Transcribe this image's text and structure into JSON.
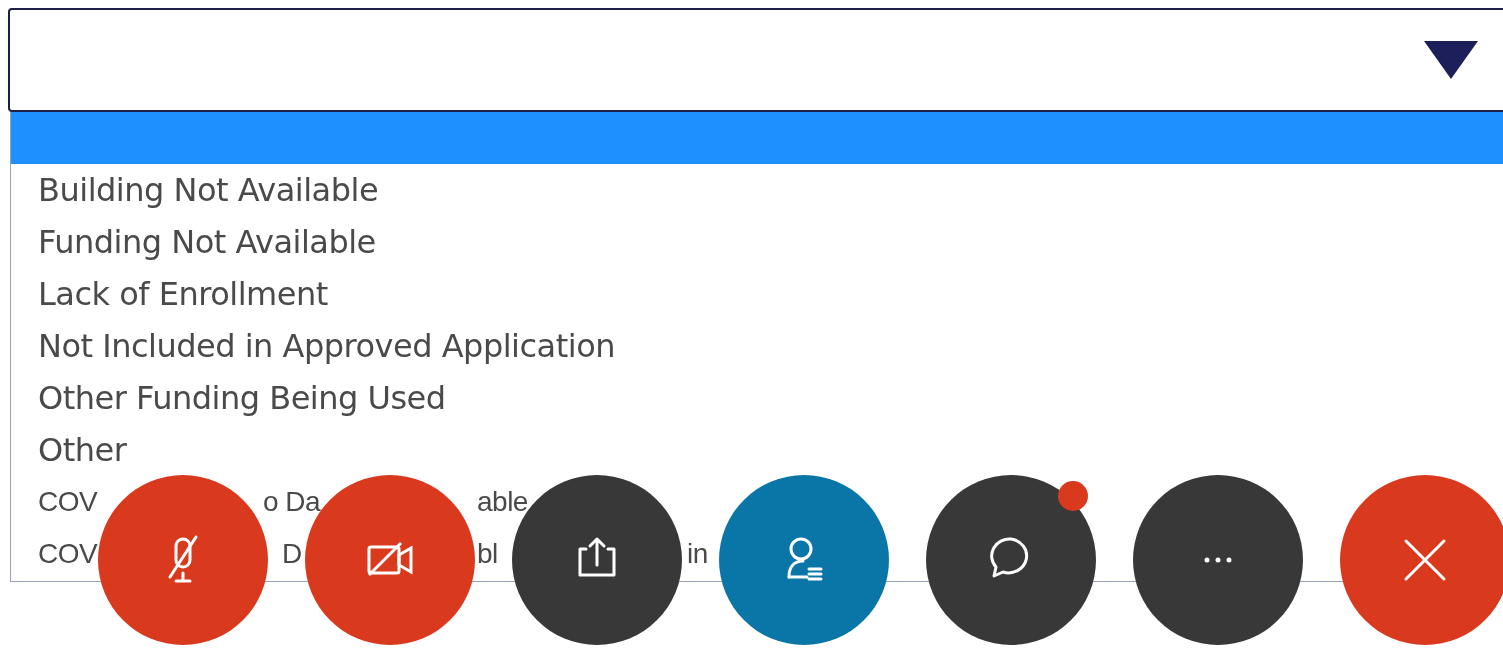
{
  "dropdown": {
    "expanded": true,
    "options": [
      {
        "selected": true
      },
      {
        "label": "Building Not Available",
        "selected": false
      },
      {
        "label": "Funding Not Available",
        "selected": false
      },
      {
        "label": "Lack of Enrollment",
        "selected": false
      },
      {
        "label": "Not Included in Approved Application",
        "selected": false
      },
      {
        "label": "Other Funding Being Used",
        "selected": false
      },
      {
        "label": "Other",
        "selected": false
      },
      {
        "fragments": [
          "COV",
          "o Da",
          "able"
        ],
        "selected": false
      },
      {
        "fragments": [
          "COV",
          "D",
          "bl",
          "in"
        ],
        "selected": false
      }
    ]
  },
  "call_controls": [
    {
      "kind": "mic",
      "color": "#d93a1e"
    },
    {
      "kind": "video",
      "color": "#d93a1e"
    },
    {
      "kind": "share",
      "color": "#383838"
    },
    {
      "kind": "participants",
      "color": "#0a76a8"
    },
    {
      "kind": "chat",
      "color": "#383838",
      "badge": true
    },
    {
      "kind": "more",
      "color": "#383838"
    },
    {
      "kind": "leave",
      "color": "#d93a1e"
    }
  ]
}
